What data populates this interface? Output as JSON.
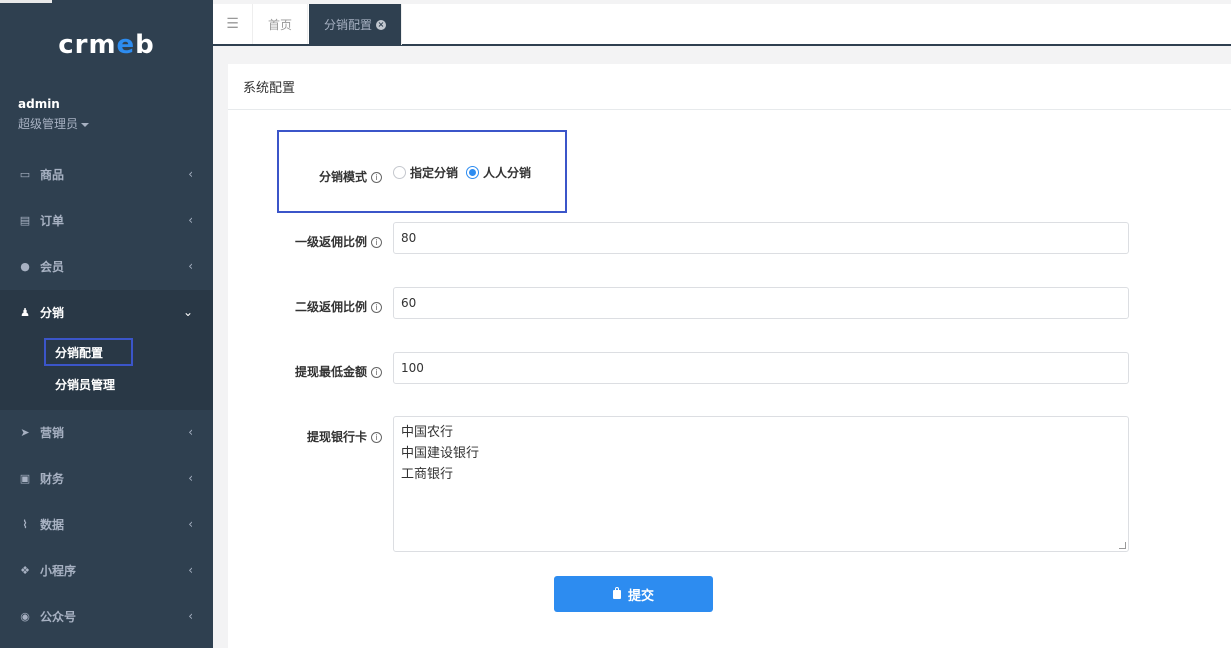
{
  "sidebar": {
    "logo": {
      "pre": "crm",
      "e": "e",
      "post": "b"
    },
    "user": {
      "name": "admin",
      "role": "超级管理员"
    },
    "nav": [
      {
        "label": "商品",
        "icon": "monitor-icon"
      },
      {
        "label": "订单",
        "icon": "receipt-icon"
      },
      {
        "label": "会员",
        "icon": "user-icon"
      },
      {
        "label": "分销",
        "icon": "users-icon"
      },
      {
        "label": "营销",
        "icon": "send-icon"
      },
      {
        "label": "财务",
        "icon": "money-icon"
      },
      {
        "label": "数据",
        "icon": "chart-icon"
      },
      {
        "label": "小程序",
        "icon": "cubes-icon"
      },
      {
        "label": "公众号",
        "icon": "wechat-icon"
      }
    ],
    "subnav": [
      {
        "label": "分销配置"
      },
      {
        "label": "分销员管理"
      }
    ]
  },
  "tabs": [
    {
      "label": "首页"
    },
    {
      "label": "分销配置"
    }
  ],
  "panel": {
    "title": "系统配置",
    "fields": {
      "mode": {
        "label": "分销模式",
        "options": [
          "指定分销",
          "人人分销"
        ],
        "selected": "人人分销"
      },
      "level1": {
        "label": "一级返佣比例",
        "value": "80"
      },
      "level2": {
        "label": "二级返佣比例",
        "value": "60"
      },
      "min_withdraw": {
        "label": "提现最低金额",
        "value": "100"
      },
      "bank_cards": {
        "label": "提现银行卡",
        "lines": [
          "中国农行",
          "中国建设银行",
          "工商银行"
        ]
      }
    },
    "submit_label": "提交"
  },
  "colors": {
    "sidebar_bg": "#2f4050",
    "accent": "#2d8cf0",
    "highlight": "#3b55c9"
  }
}
